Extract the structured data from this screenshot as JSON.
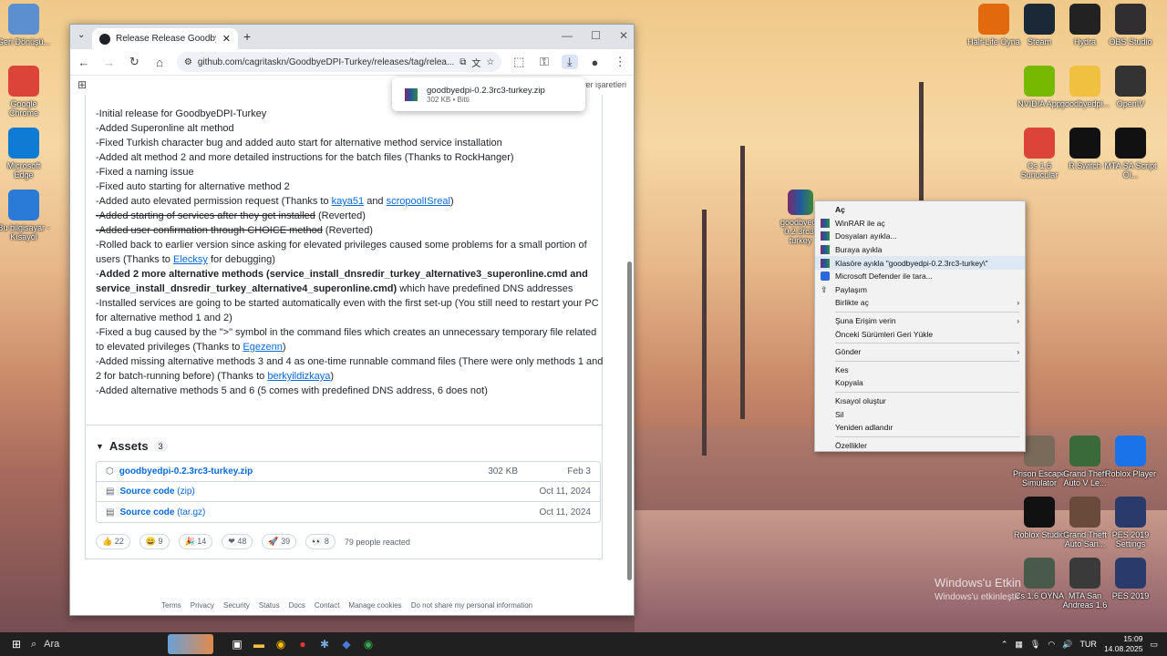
{
  "desktop": {
    "left_icons": [
      {
        "label": "Geri Dönüşü...",
        "icon": "recycle-bin-icon",
        "color": "#5a8fd0"
      },
      {
        "label": "Google Chrome",
        "icon": "chrome-icon",
        "color": "#db4437"
      },
      {
        "label": "Microsoft Edge",
        "icon": "edge-icon",
        "color": "#0f7bd4"
      },
      {
        "label": "Bu bilgisayar - Kısayol",
        "icon": "computer-icon",
        "color": "#2a7ad8"
      }
    ],
    "right_icons": [
      {
        "label": "Half-Life Oyna",
        "icon": "half-life-icon",
        "color": "#e3690f"
      },
      {
        "label": "Steam",
        "icon": "steam-icon",
        "color": "#1b2838"
      },
      {
        "label": "Hydra",
        "icon": "hydra-icon",
        "color": "#222"
      },
      {
        "label": "OBS Studio",
        "icon": "obs-icon",
        "color": "#302e31"
      },
      {
        "label": "NVIDIA App",
        "icon": "nvidia-icon",
        "color": "#76b900"
      },
      {
        "label": "goodbyedpi...",
        "icon": "folder-icon",
        "color": "#f0c040"
      },
      {
        "label": "OpenIV",
        "icon": "openiv-icon",
        "color": "#333"
      },
      {
        "label": "Cs 1.6 Sunucular",
        "icon": "chrome-icon",
        "color": "#db4437"
      },
      {
        "label": "R.Switch",
        "icon": "res-switch-icon",
        "color": "#111"
      },
      {
        "label": "MTA SA Script Ol...",
        "icon": "rockstar-icon",
        "color": "#111"
      },
      {
        "label": "Prison Escape Simulator",
        "icon": "game-icon",
        "color": "#7a6a5a"
      },
      {
        "label": "Grand Theft Auto V Le...",
        "icon": "gta5-icon",
        "color": "#3a6a3a"
      },
      {
        "label": "Roblox Player",
        "icon": "roblox-icon",
        "color": "#1a73e8"
      },
      {
        "label": "Roblox Studio",
        "icon": "roblox-studio-icon",
        "color": "#111"
      },
      {
        "label": "Grand Theft Auto San...",
        "icon": "gta-sa-icon",
        "color": "#6a4a3a"
      },
      {
        "label": "PES 2019 Settings",
        "icon": "pes-icon",
        "color": "#2a3a6a"
      },
      {
        "label": "Cs 1.6 OYNA",
        "icon": "cs-icon",
        "color": "#4a5a4a"
      },
      {
        "label": "MTA San Andreas 1.6",
        "icon": "mta-icon",
        "color": "#3a3a3a"
      },
      {
        "label": "PES 2019",
        "icon": "pes-icon",
        "color": "#2a3a6a"
      }
    ],
    "file_icon_label": "goodbyedpi-0.2.3rc3-turkey"
  },
  "browser": {
    "tab_title": "Release Release GoodbyeDPI-T...",
    "url": "github.com/cagritaskn/GoodbyeDPI-Turkey/releases/tag/relea...",
    "bookmarks_right": "Tüm yer işaretleri",
    "download_popup": {
      "name": "goodbyedpi-0.2.3rc3-turkey.zip",
      "status": "302 KB • Bitti"
    }
  },
  "release": {
    "notes": [
      {
        "text": "-Initial release for GoodbyeDPI-Turkey"
      },
      {
        "text": "-Added Superonline alt method"
      },
      {
        "text": "-Fixed Turkish character bug and added auto start for alternative method service installation"
      },
      {
        "text": "-Added alt method 2 and more detailed instructions for the batch files (Thanks to RockHanger)"
      },
      {
        "text": "-Fixed a naming issue"
      },
      {
        "text": "-Fixed auto starting for alternative method 2"
      }
    ],
    "n7_pre": "-Added auto elevated permission request (Thanks to ",
    "n7_link1": "kaya51",
    "n7_mid": " and ",
    "n7_link2": "scropoolISreal",
    "n7_post": ")",
    "n8_strike": "-Added starting of services after they get installed",
    "n8_post": " (Reverted)",
    "n9_strike": "-Added user confirmation through CHOICE method",
    "n9_post": " (Reverted)",
    "n10": "-Rolled back to earlier version since asking for elevated privileges caused some problems for a small portion of users (Thanks to ",
    "n10_link": "Elecksy",
    "n10_post": " for debugging)",
    "n11_pre": "-",
    "n11_bold": "Added 2 more alternative methods (service_install_dnsredir_turkey_alternative3_superonline.cmd and service_install_dnsredir_turkey_alternative4_superonline.cmd)",
    "n11_post": " which have predefined DNS addresses",
    "n12": "-Installed services are going to be started automatically even with the first set-up (You still need to restart your PC for alternative method 1 and 2)",
    "n13": "-Fixed a bug caused by the \">\" symbol in the command files which creates an unnecessary temporary file related to elevated privileges (Thanks to ",
    "n13_link": "Egezenn",
    "n13_post": ")",
    "n14": "-Added missing alternative methods 3 and 4 as one-time runnable command files (There were only methods 1 and 2 for batch-running before) (Thanks to ",
    "n14_link": "berkyildizkaya",
    "n14_post": ")",
    "n15": "-Added alternative methods 5 and 6 (5 comes with predefined DNS address, 6 does not)",
    "assets_title": "Assets",
    "assets_count": "3",
    "assets": [
      {
        "name": "goodbyedpi-0.2.3rc3-turkey.zip",
        "suffix": "",
        "size": "302 KB",
        "date": "Feb 3"
      },
      {
        "name": "Source code",
        "suffix": " (zip)",
        "size": "",
        "date": "Oct 11, 2024"
      },
      {
        "name": "Source code",
        "suffix": " (tar.gz)",
        "size": "",
        "date": "Oct 11, 2024"
      }
    ],
    "reactions": [
      {
        "emoji": "👍",
        "count": "22"
      },
      {
        "emoji": "😄",
        "count": "9"
      },
      {
        "emoji": "🎉",
        "count": "14"
      },
      {
        "emoji": "❤",
        "count": "48"
      },
      {
        "emoji": "🚀",
        "count": "39"
      },
      {
        "emoji": "👀",
        "count": "8"
      }
    ],
    "reacted_text": "79 people reacted"
  },
  "footer": [
    "Terms",
    "Privacy",
    "Security",
    "Status",
    "Docs",
    "Contact",
    "Manage cookies",
    "Do not share my personal information"
  ],
  "context_menu": {
    "items": [
      {
        "label": "Aç",
        "bold": true
      },
      {
        "label": "WinRAR ile aç",
        "icon": "winrar"
      },
      {
        "label": "Dosyaları ayıkla...",
        "icon": "winrar"
      },
      {
        "label": "Buraya ayıkla",
        "icon": "winrar"
      },
      {
        "label": "Klasöre ayıkla \"goodbyedpi-0.2.3rc3-turkey\\\"",
        "icon": "winrar",
        "highlight": true
      },
      {
        "label": "Microsoft Defender ile tara...",
        "icon": "defender"
      },
      {
        "label": "Paylaşım",
        "icon": "share"
      },
      {
        "label": "Birlikte aç",
        "arrow": true
      },
      {
        "sep": true
      },
      {
        "label": "Şuna Erişim verin",
        "arrow": true
      },
      {
        "label": "Önceki Sürümleri Geri Yükle"
      },
      {
        "sep": true
      },
      {
        "label": "Gönder",
        "arrow": true
      },
      {
        "sep": true
      },
      {
        "label": "Kes"
      },
      {
        "label": "Kopyala"
      },
      {
        "sep": true
      },
      {
        "label": "Kısayol oluştur"
      },
      {
        "label": "Sil"
      },
      {
        "label": "Yeniden adlandır"
      },
      {
        "sep": true
      },
      {
        "label": "Özellikler"
      }
    ]
  },
  "watermark": {
    "line1": "Windows'u Etkin",
    "line2": "Windows'u etkinleştir"
  },
  "taskbar": {
    "search": "Ara",
    "lang": "TUR",
    "time": "15:09",
    "date": "14.08.2025"
  }
}
